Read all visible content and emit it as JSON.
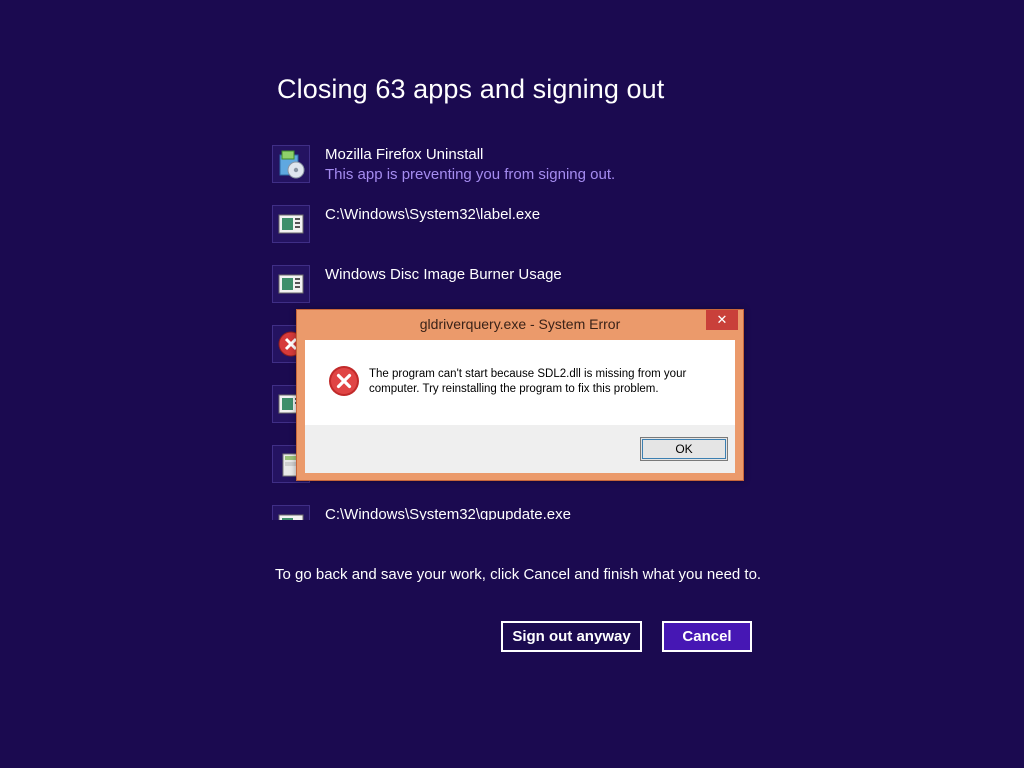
{
  "screen": {
    "title": "Closing 63 apps and signing out",
    "hint": "To go back and save your work, click Cancel and finish what you need to.",
    "colors": {
      "background": "#1b0a50",
      "status_text": "#a58cf0",
      "cancel_button": "#4617b4"
    }
  },
  "apps": [
    {
      "name": "Mozilla Firefox Uninstall",
      "status": "This app is preventing you from signing out.",
      "icon": "installer-icon"
    },
    {
      "name": "C:\\Windows\\System32\\label.exe",
      "status": "",
      "icon": "program-window-icon"
    },
    {
      "name": "Windows Disc Image Burner Usage",
      "status": "",
      "icon": "program-window-icon"
    },
    {
      "name": "",
      "status": "",
      "icon": "error-icon"
    },
    {
      "name": "",
      "status": "",
      "icon": "program-window-icon"
    },
    {
      "name": "",
      "status": "",
      "icon": "file-cabinet-icon"
    },
    {
      "name": "C:\\Windows\\System32\\gpupdate.exe",
      "status": "",
      "icon": "program-window-icon"
    }
  ],
  "buttons": {
    "sign_out": "Sign out anyway",
    "cancel": "Cancel"
  },
  "dialog": {
    "title": "gldriverquery.exe - System Error",
    "close": "✕",
    "message": "The program can't start because SDL2.dll is missing from your computer. Try reinstalling the program to fix this problem.",
    "ok": "OK",
    "icon": "error-icon",
    "colors": {
      "frame": "#eb9a6b",
      "close_button": "#c9403a"
    }
  }
}
